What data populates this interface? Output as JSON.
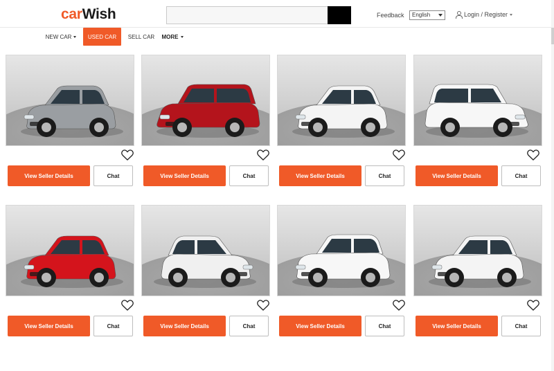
{
  "header": {
    "logo_part1": "car",
    "logo_part2": "Wish",
    "search": {
      "value": "",
      "placeholder": ""
    },
    "feedback_label": "Feedback",
    "language": "English",
    "login_label": "Login / Register"
  },
  "nav": {
    "items": [
      {
        "label": "NEW CAR",
        "has_dropdown": true
      },
      {
        "label": "USED CAR",
        "active": true
      },
      {
        "label": "SELL CAR"
      },
      {
        "label": "MORE",
        "has_dropdown": true
      }
    ]
  },
  "theme": {
    "accent": "#f05a28"
  },
  "listings": [
    {
      "car_color": "#9a9ea2",
      "body": "hatch",
      "facing": "left",
      "view_label": "View Seller Details",
      "chat_label": "Chat"
    },
    {
      "car_color": "#b4141c",
      "body": "suv",
      "facing": "left",
      "view_label": "View Seller Details",
      "chat_label": "Chat"
    },
    {
      "car_color": "#f4f4f4",
      "body": "hatch",
      "facing": "left",
      "view_label": "View Seller Details",
      "chat_label": "Chat"
    },
    {
      "car_color": "#f7f7f7",
      "body": "suv",
      "facing": "right",
      "view_label": "View Seller Details",
      "chat_label": "Chat"
    },
    {
      "car_color": "#d4141c",
      "body": "hatch",
      "facing": "left",
      "view_label": "View Seller Details",
      "chat_label": "Chat"
    },
    {
      "car_color": "#f0f0f0",
      "body": "hatch",
      "facing": "right",
      "view_label": "View Seller Details",
      "chat_label": "Chat"
    },
    {
      "car_color": "#f7f7f7",
      "body": "crossover",
      "facing": "left",
      "view_label": "View Seller Details",
      "chat_label": "Chat"
    },
    {
      "car_color": "#f4f4f4",
      "body": "hatch",
      "facing": "left",
      "view_label": "View Seller Details",
      "chat_label": "Chat"
    }
  ]
}
